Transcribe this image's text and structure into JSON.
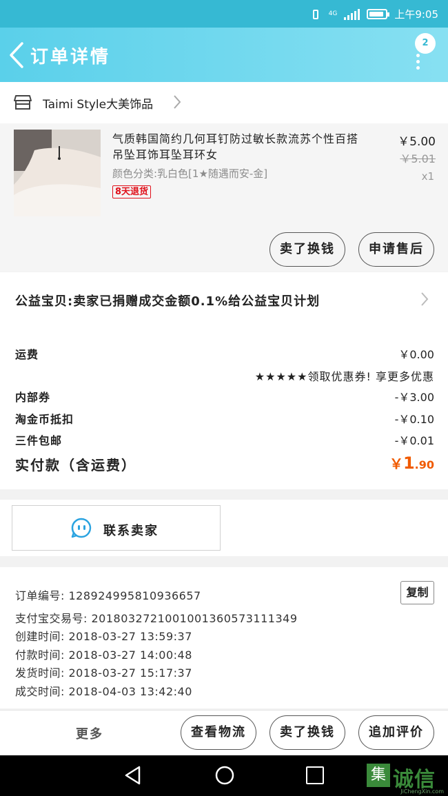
{
  "status_bar": {
    "network": "4G",
    "time": "上午9:05",
    "battery_level": 0.9
  },
  "header": {
    "title": "订单详情",
    "badge_count": "2"
  },
  "shop": {
    "name": "Taimi Style大美饰品"
  },
  "product": {
    "title": "气质韩国简约几何耳钉防过敏长款流苏个性百搭吊坠耳饰耳坠耳环女",
    "sku": "颜色分类:乳白色[1★随遇而安-金]",
    "tag": "8天退货",
    "price": "￥5.00",
    "original_price": "￥5.01",
    "quantity": "x1",
    "buttons": {
      "refund": "卖了换钱",
      "after_sale": "申请售后"
    }
  },
  "charity": {
    "text": "公益宝贝:卖家已捐赠成交金额0.1%给公益宝贝计划"
  },
  "fees": {
    "shipping_label": "运费",
    "shipping_value": "￥0.00",
    "promo": "★★★★★领取优惠券! 享更多优惠",
    "coupon_label": "内部券",
    "coupon_value": "-￥3.00",
    "coin_label": "淘金币抵扣",
    "coin_value": "-￥0.10",
    "bundle_label": "三件包邮",
    "bundle_value": "-￥0.01",
    "total_label": "实付款（含运费）",
    "total_currency": "￥",
    "total_int": "1",
    "total_dec": ".90"
  },
  "contact": {
    "label": "联系卖家"
  },
  "order_info": {
    "order_no": "订单编号: 128924995810936657",
    "alipay_no": "支付宝交易号: 2018032721001001360573111349",
    "created": "创建时间: 2018-03-27 13:59:37",
    "paid": "付款时间: 2018-03-27 14:00:48",
    "shipped": "发货时间: 2018-03-27 15:17:37",
    "completed": "成交时间: 2018-04-03 13:42:40",
    "copy_label": "复制"
  },
  "bottom_bar": {
    "more": "更多",
    "logistics": "查看物流",
    "resell": "卖了换钱",
    "add_review": "追加评价"
  },
  "watermark": {
    "brand": "诚信",
    "box_char": "集",
    "url": "JiChengXin.com"
  },
  "colors": {
    "header_start": "#5ad0ea",
    "header_end": "#87e0f2",
    "status_bar": "#36b9d3",
    "total_price": "#f05a00",
    "tag_red": "#e0101a"
  }
}
